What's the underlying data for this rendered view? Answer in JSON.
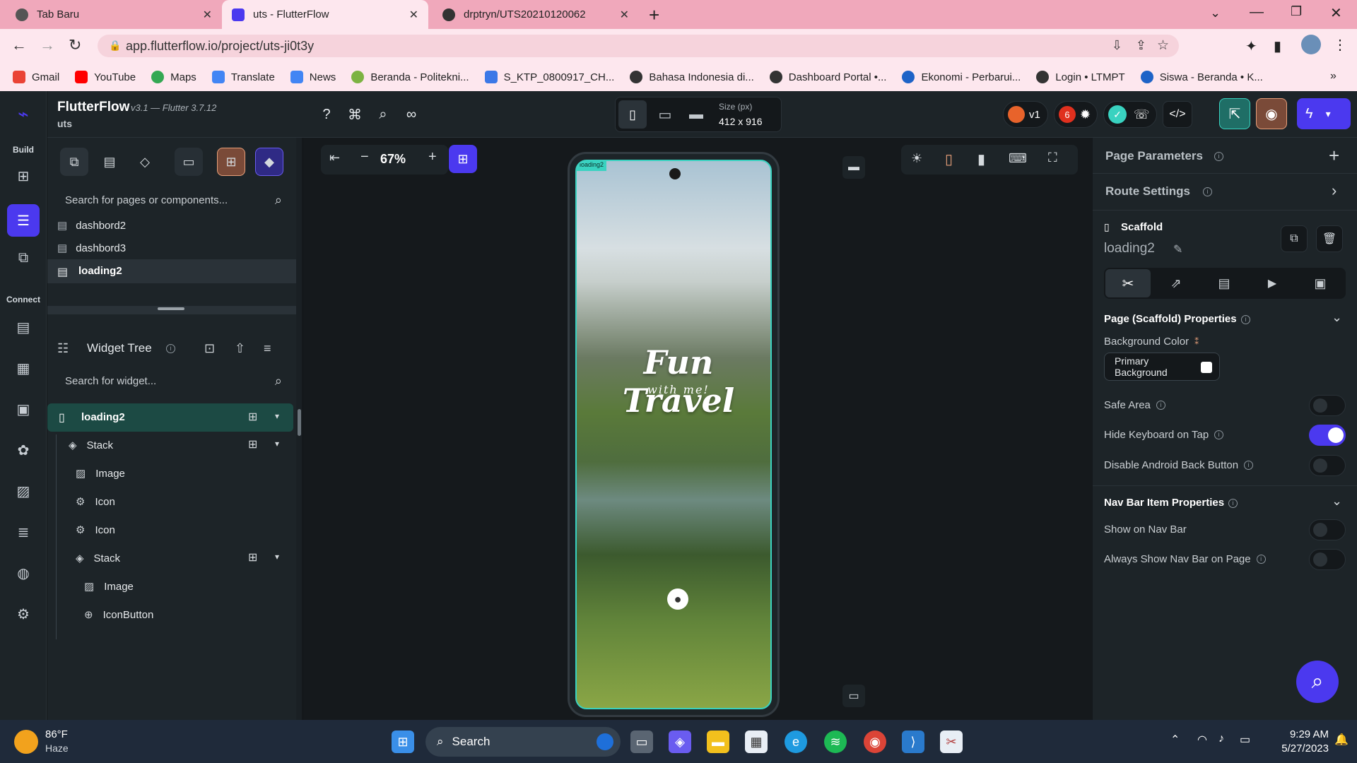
{
  "browser": {
    "tabs": [
      {
        "label": "Tab Baru",
        "active": false
      },
      {
        "label": "uts - FlutterFlow",
        "active": true
      },
      {
        "label": "drptryn/UTS20210120062",
        "active": false
      }
    ],
    "url": "app.flutterflow.io/project/uts-ji0t3y",
    "bookmarks": [
      "Gmail",
      "YouTube",
      "Maps",
      "Translate",
      "News",
      "Beranda - Politekni...",
      "S_KTP_0800917_CH...",
      "Bahasa Indonesia di...",
      "Dashboard Portal •...",
      "Ekonomi - Perbarui...",
      "Login • LTMPT",
      "Siswa - Beranda • K..."
    ]
  },
  "app": {
    "name": "FlutterFlow",
    "version": "v3.1 — Flutter 3.7.12",
    "project": "uts",
    "rail": {
      "build_label": "Build",
      "connect_label": "Connect"
    },
    "zoom": "67%",
    "size_label": "Size (px)",
    "size_value": "412 x 916",
    "version_badge": "v1",
    "issues_count": "6"
  },
  "left_panel": {
    "search_placeholder": "Search for pages or components...",
    "pages": [
      {
        "label": "dashbord2",
        "selected": false
      },
      {
        "label": "dashbord3",
        "selected": false
      },
      {
        "label": "loading2",
        "selected": true
      }
    ],
    "widget_tree_title": "Widget Tree",
    "widget_search_placeholder": "Search for widget...",
    "tree": [
      {
        "label": "loading2",
        "icon": "phone-icon",
        "level": 0
      },
      {
        "label": "Stack",
        "icon": "stack-icon",
        "level": 1
      },
      {
        "label": "Image",
        "icon": "image-icon",
        "level": 2
      },
      {
        "label": "Icon",
        "icon": "gear-icon",
        "level": 2
      },
      {
        "label": "Icon",
        "icon": "gear-icon",
        "level": 2
      },
      {
        "label": "Stack",
        "icon": "stack-icon",
        "level": 2
      },
      {
        "label": "Image",
        "icon": "image-icon",
        "level": 3
      },
      {
        "label": "IconButton",
        "icon": "plus-circle-icon",
        "level": 3
      }
    ]
  },
  "canvas": {
    "page_tag": "loading2",
    "title_line1": "Fun Travel",
    "title_line2": "with me!"
  },
  "right_panel": {
    "page_parameters": "Page Parameters",
    "route_settings": "Route Settings",
    "scaffold_label": "Scaffold",
    "page_name": "loading2",
    "scaffold_section": "Page (Scaffold) Properties",
    "background_color_label": "Background Color",
    "background_color_value": "Primary Background",
    "safe_area_label": "Safe Area",
    "safe_area_on": false,
    "hide_keyboard_label": "Hide Keyboard on Tap",
    "hide_keyboard_on": true,
    "disable_back_label": "Disable Android Back Button",
    "disable_back_on": false,
    "navbar_section": "Nav Bar Item Properties",
    "show_nav_label": "Show on Nav Bar",
    "show_nav_on": false,
    "always_show_label": "Always Show Nav Bar on Page",
    "always_show_on": false
  },
  "taskbar": {
    "temp": "86°F",
    "weather": "Haze",
    "search_label": "Search",
    "time": "9:29 AM",
    "date": "5/27/2023"
  },
  "colors": {
    "accent": "#4b39ef",
    "teal": "#39d2c0",
    "tabbar": "#f0a8bb",
    "panel": "#1d2428"
  }
}
